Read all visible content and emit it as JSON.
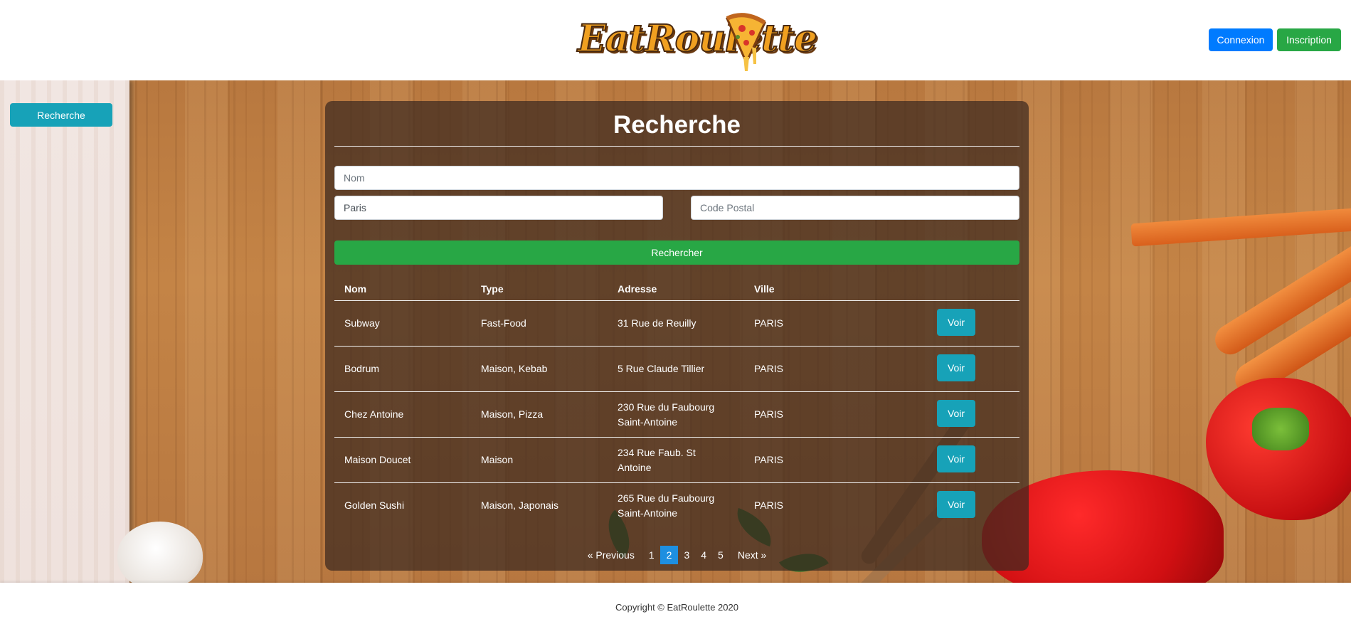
{
  "header": {
    "logo_text": "EatRoulette",
    "login_label": "Connexion",
    "signup_label": "Inscription"
  },
  "sidebar": {
    "search_label": "Recherche"
  },
  "search": {
    "title": "Recherche",
    "nom_placeholder": "Nom",
    "ville_value": "Paris",
    "cp_placeholder": "Code Postal",
    "submit_label": "Rechercher"
  },
  "table": {
    "headers": [
      "Nom",
      "Type",
      "Adresse",
      "Ville"
    ],
    "rows": [
      {
        "nom": "Subway",
        "type": "Fast-Food",
        "adresse": "31 Rue de Reuilly",
        "ville": "PARIS",
        "action": "Voir"
      },
      {
        "nom": "Bodrum",
        "type": "Maison, Kebab",
        "adresse": "5 Rue Claude Tillier",
        "ville": "PARIS",
        "action": "Voir"
      },
      {
        "nom": "Chez Antoine",
        "type": "Maison, Pizza",
        "adresse": "230 Rue du Faubourg Saint-Antoine",
        "ville": "PARIS",
        "action": "Voir"
      },
      {
        "nom": "Maison Doucet",
        "type": "Maison",
        "adresse": "234 Rue Faub. St Antoine",
        "ville": "PARIS",
        "action": "Voir"
      },
      {
        "nom": "Golden Sushi",
        "type": "Maison, Japonais",
        "adresse": "265 Rue du Faubourg Saint-Antoine",
        "ville": "PARIS",
        "action": "Voir"
      }
    ]
  },
  "pagination": {
    "prev_label": "«  Previous",
    "pages": [
      "1",
      "2",
      "3",
      "4",
      "5"
    ],
    "active_page": "2",
    "next_label": "Next  »"
  },
  "footer": {
    "copyright": "Copyright © EatRoulette 2020"
  },
  "colors": {
    "primary": "#007bff",
    "success": "#28a745",
    "info": "#17a2b8",
    "page_active": "#1e8fe0"
  }
}
